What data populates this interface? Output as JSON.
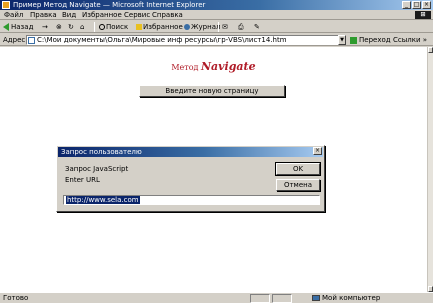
{
  "window": {
    "title": "Пример Метод Navigate — Microsoft Internet Explorer",
    "min_glyph": "_",
    "max_glyph": "□",
    "close_glyph": "×",
    "brand_glyph": "⊞"
  },
  "menu": {
    "items": [
      "Файл",
      "Правка",
      "Вид",
      "Избранное",
      "Сервис",
      "Справка"
    ]
  },
  "toolbar": {
    "back": "Назад",
    "forward": "→",
    "stop": "⊗",
    "refresh": "↻",
    "home": "⌂",
    "search": "Поиск",
    "favorites": "Избранное",
    "history": "Журнал",
    "mail": "✉",
    "print": "⎙",
    "edit": "✎"
  },
  "address_bar": {
    "label": "Адрес",
    "value": "C:\\Мои документы\\Ольга\\Мировые инф ресурсы\\гр-VBS\\лист14.htm",
    "drop_glyph": "▼",
    "go_label": "Переход",
    "links_label": "Ссылки »"
  },
  "page": {
    "heading_prefix": "Метод",
    "heading_name": "Navigate",
    "button_label": "Введите новую страницу"
  },
  "dialog": {
    "title": "Запрос пользователю",
    "line1": "Запрос JavaScript",
    "line2": "Enter URL",
    "ok_label": "OK",
    "cancel_label": "Отмена",
    "input_value": "http://www.sela.com",
    "close_glyph": "×"
  },
  "status_bar": {
    "text": "Готово",
    "zone": "Мой компьютер"
  }
}
